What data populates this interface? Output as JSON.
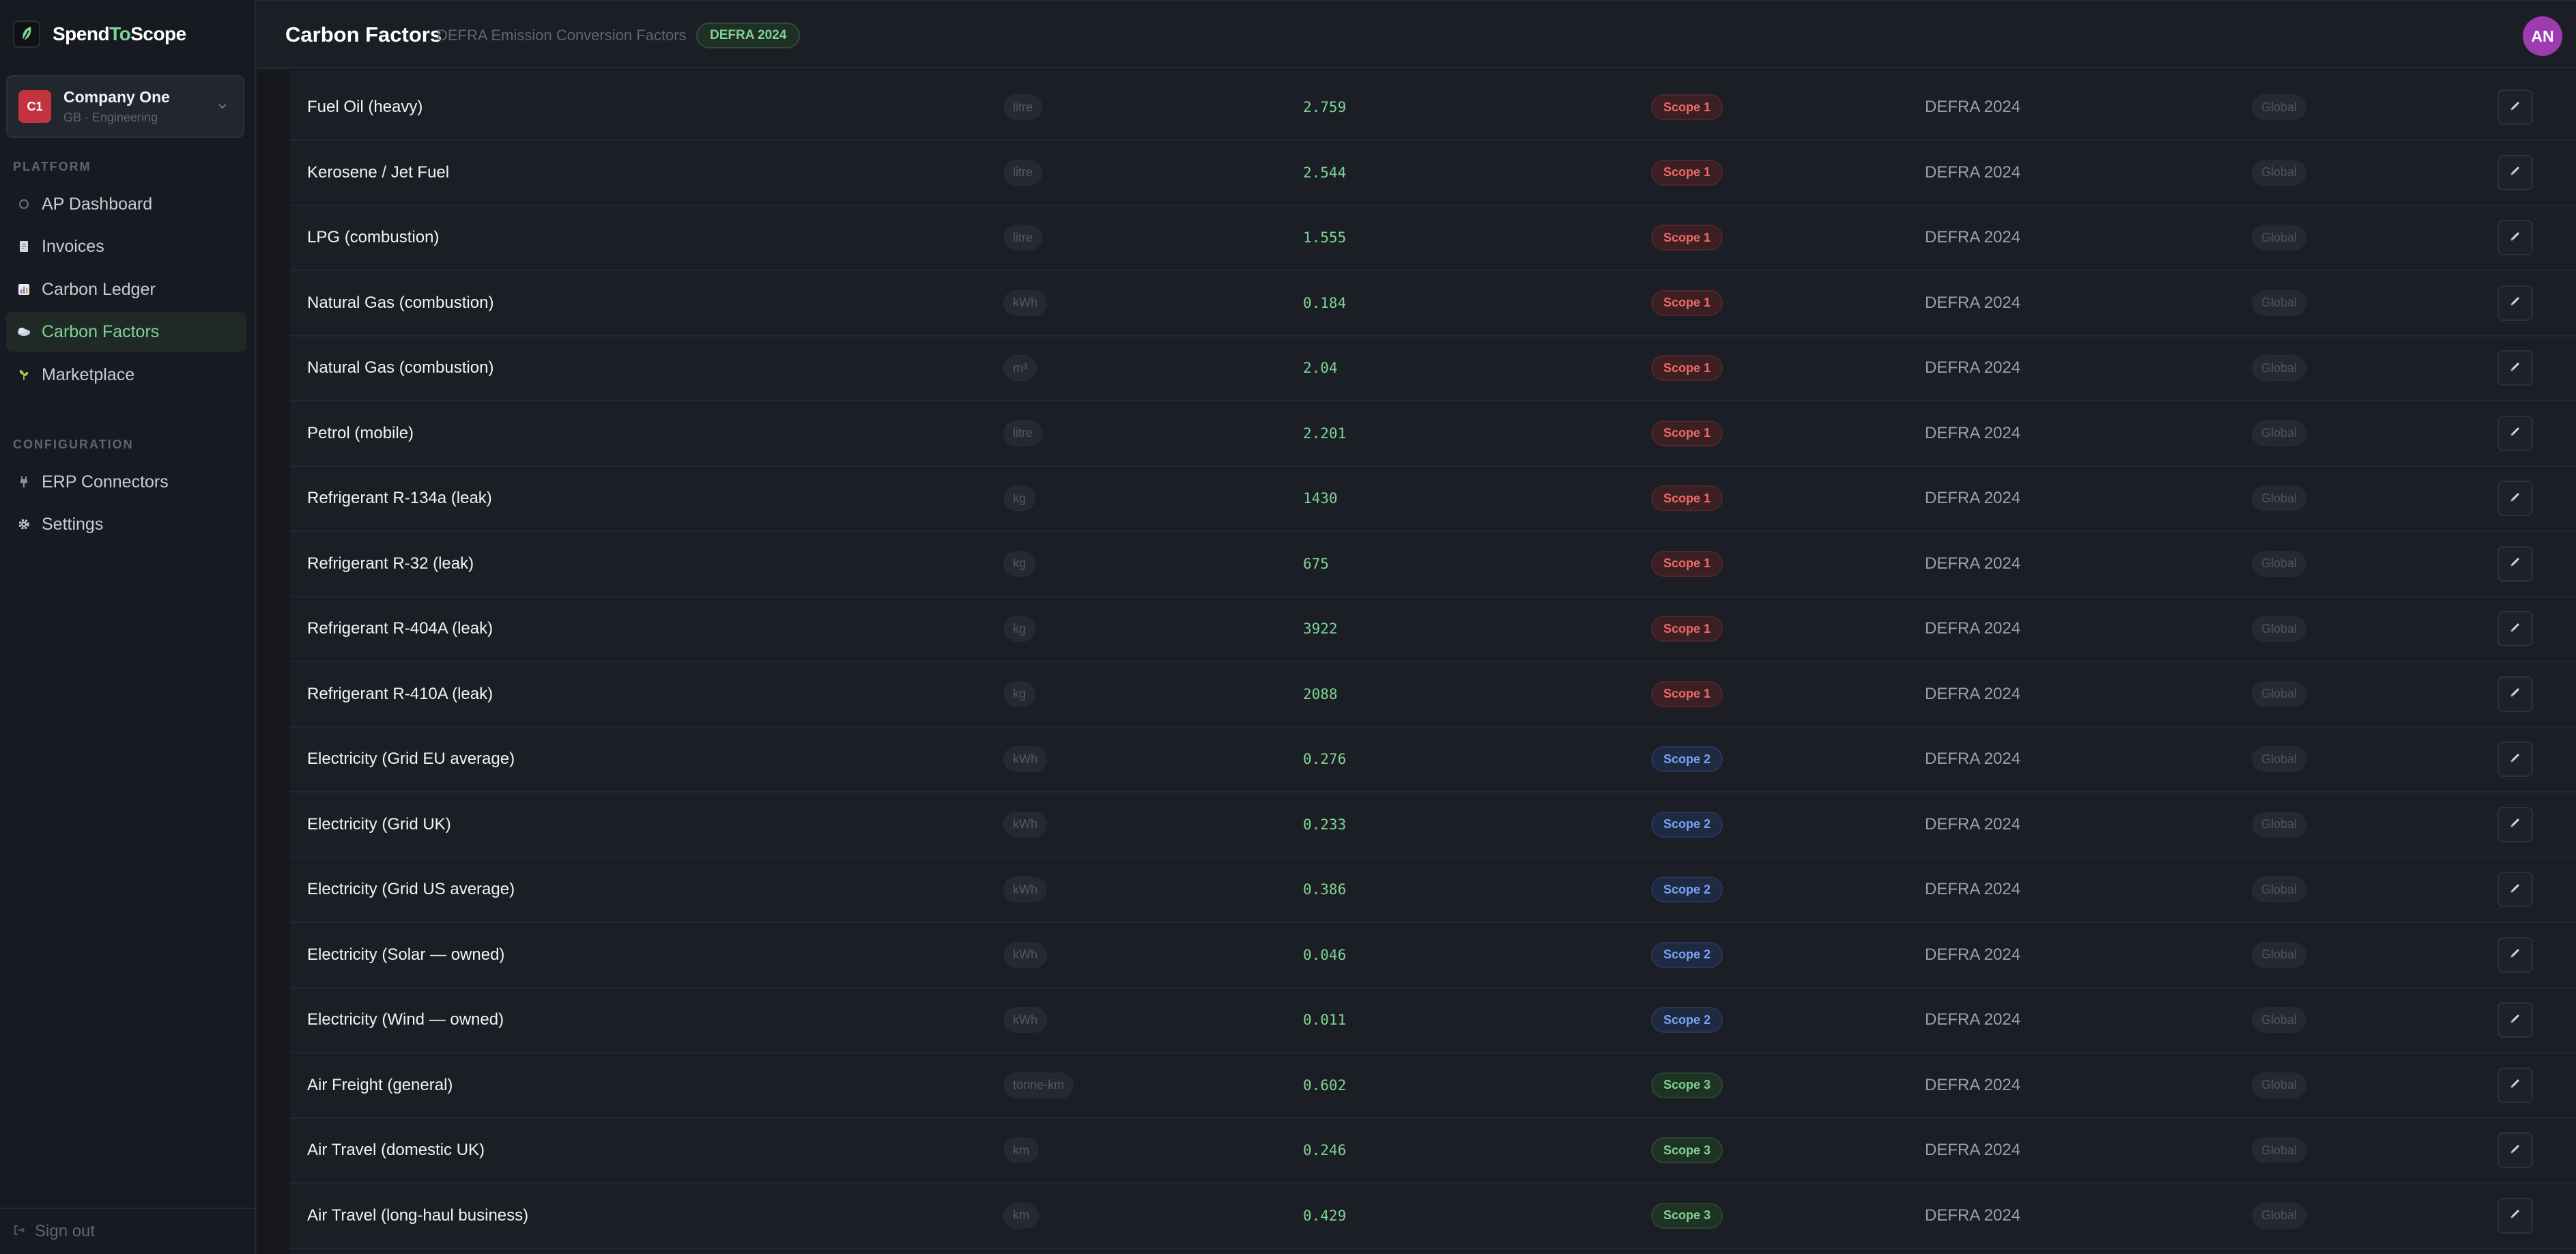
{
  "brand": {
    "name_part1": "Spend",
    "name_part2": "To",
    "name_part3": "Scope"
  },
  "company": {
    "avatar": "C1",
    "name": "Company One",
    "subtitle": "GB · Engineering"
  },
  "sidebar": {
    "platform_label": "PLATFORM",
    "platform_items": [
      {
        "label": "AP Dashboard",
        "icon": "circle-icon",
        "active": false
      },
      {
        "label": "Invoices",
        "icon": "document-icon",
        "active": false
      },
      {
        "label": "Carbon Ledger",
        "icon": "bar-chart-icon",
        "active": false
      },
      {
        "label": "Carbon Factors",
        "icon": "cloud-icon",
        "active": true
      },
      {
        "label": "Marketplace",
        "icon": "sprout-icon",
        "active": false
      }
    ],
    "config_label": "CONFIGURATION",
    "config_items": [
      {
        "label": "ERP Connectors",
        "icon": "plug-icon"
      },
      {
        "label": "Settings",
        "icon": "gear-icon"
      }
    ],
    "signout": "Sign out"
  },
  "header": {
    "title": "Carbon Factors",
    "subtitle": "DEFRA Emission Conversion Factors",
    "badge": "DEFRA 2024",
    "user_initials": "AN"
  },
  "colors": {
    "accent": "#7ed492",
    "scope1": "#ef6a66",
    "scope2": "#79a5f5",
    "scope3": "#7ed492",
    "avatar": "#9d3bb0",
    "company_avatar": "#c4343f"
  },
  "factors": [
    {
      "name": "Fuel Oil (heavy)",
      "unit": "litre",
      "value": "2.759",
      "scope": "Scope 1",
      "scope_class": "scope-1",
      "source": "DEFRA 2024",
      "region": "Global"
    },
    {
      "name": "Kerosene / Jet Fuel",
      "unit": "litre",
      "value": "2.544",
      "scope": "Scope 1",
      "scope_class": "scope-1",
      "source": "DEFRA 2024",
      "region": "Global"
    },
    {
      "name": "LPG (combustion)",
      "unit": "litre",
      "value": "1.555",
      "scope": "Scope 1",
      "scope_class": "scope-1",
      "source": "DEFRA 2024",
      "region": "Global"
    },
    {
      "name": "Natural Gas (combustion)",
      "unit": "kWh",
      "value": "0.184",
      "scope": "Scope 1",
      "scope_class": "scope-1",
      "source": "DEFRA 2024",
      "region": "Global"
    },
    {
      "name": "Natural Gas (combustion)",
      "unit": "m³",
      "value": "2.04",
      "scope": "Scope 1",
      "scope_class": "scope-1",
      "source": "DEFRA 2024",
      "region": "Global"
    },
    {
      "name": "Petrol (mobile)",
      "unit": "litre",
      "value": "2.201",
      "scope": "Scope 1",
      "scope_class": "scope-1",
      "source": "DEFRA 2024",
      "region": "Global"
    },
    {
      "name": "Refrigerant R-134a (leak)",
      "unit": "kg",
      "value": "1430",
      "scope": "Scope 1",
      "scope_class": "scope-1",
      "source": "DEFRA 2024",
      "region": "Global"
    },
    {
      "name": "Refrigerant R-32 (leak)",
      "unit": "kg",
      "value": "675",
      "scope": "Scope 1",
      "scope_class": "scope-1",
      "source": "DEFRA 2024",
      "region": "Global"
    },
    {
      "name": "Refrigerant R-404A (leak)",
      "unit": "kg",
      "value": "3922",
      "scope": "Scope 1",
      "scope_class": "scope-1",
      "source": "DEFRA 2024",
      "region": "Global"
    },
    {
      "name": "Refrigerant R-410A (leak)",
      "unit": "kg",
      "value": "2088",
      "scope": "Scope 1",
      "scope_class": "scope-1",
      "source": "DEFRA 2024",
      "region": "Global"
    },
    {
      "name": "Electricity (Grid EU average)",
      "unit": "kWh",
      "value": "0.276",
      "scope": "Scope 2",
      "scope_class": "scope-2",
      "source": "DEFRA 2024",
      "region": "Global"
    },
    {
      "name": "Electricity (Grid UK)",
      "unit": "kWh",
      "value": "0.233",
      "scope": "Scope 2",
      "scope_class": "scope-2",
      "source": "DEFRA 2024",
      "region": "Global"
    },
    {
      "name": "Electricity (Grid US average)",
      "unit": "kWh",
      "value": "0.386",
      "scope": "Scope 2",
      "scope_class": "scope-2",
      "source": "DEFRA 2024",
      "region": "Global"
    },
    {
      "name": "Electricity (Solar — owned)",
      "unit": "kWh",
      "value": "0.046",
      "scope": "Scope 2",
      "scope_class": "scope-2",
      "source": "DEFRA 2024",
      "region": "Global"
    },
    {
      "name": "Electricity (Wind — owned)",
      "unit": "kWh",
      "value": "0.011",
      "scope": "Scope 2",
      "scope_class": "scope-2",
      "source": "DEFRA 2024",
      "region": "Global"
    },
    {
      "name": "Air Freight (general)",
      "unit": "tonne-km",
      "value": "0.602",
      "scope": "Scope 3",
      "scope_class": "scope-3",
      "source": "DEFRA 2024",
      "region": "Global"
    },
    {
      "name": "Air Travel (domestic UK)",
      "unit": "km",
      "value": "0.246",
      "scope": "Scope 3",
      "scope_class": "scope-3",
      "source": "DEFRA 2024",
      "region": "Global"
    },
    {
      "name": "Air Travel (long-haul business)",
      "unit": "km",
      "value": "0.429",
      "scope": "Scope 3",
      "scope_class": "scope-3",
      "source": "DEFRA 2024",
      "region": "Global"
    }
  ]
}
